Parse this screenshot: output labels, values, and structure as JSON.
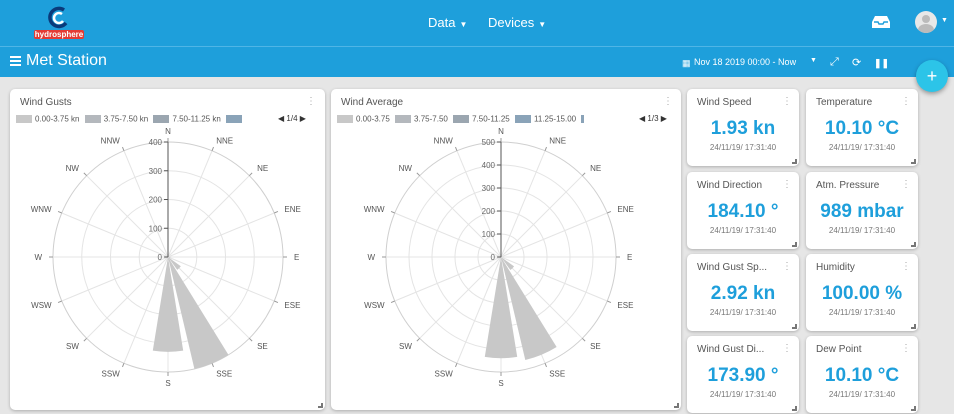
{
  "app": {
    "brand": "hydrosphere"
  },
  "nav": {
    "data_label": "Data",
    "devices_label": "Devices"
  },
  "header": {
    "title": "Met Station",
    "date_range": "Nov 18 2019 00:00 - Now"
  },
  "colors": {
    "accent": "#1e9fdb",
    "fab": "#2cc4e8",
    "wedge": "#c8c8c8"
  },
  "icons": [
    "menu-icon",
    "calendar-icon",
    "expand-icon",
    "refresh-icon",
    "pause-icon",
    "inbox-icon",
    "avatar",
    "kebab-icon",
    "resize-handle-icon",
    "plus-icon"
  ],
  "rose_directions": [
    "N",
    "NNE",
    "NE",
    "ENE",
    "E",
    "ESE",
    "SE",
    "SSE",
    "S",
    "SSW",
    "SW",
    "WSW",
    "W",
    "WNW",
    "NW",
    "NNW"
  ],
  "gusts": {
    "title": "Wind Gusts",
    "legend": [
      "0.00-3.75 kn",
      "3.75-7.50 kn",
      "7.50-11.25 kn"
    ],
    "legend_colors": [
      "#c8c8c8",
      "#b4b8bd",
      "#9ba6b0",
      "#8aa3b8"
    ],
    "pager": "1/4",
    "ticks": [
      "0",
      "100",
      "200",
      "300",
      "400"
    ]
  },
  "average": {
    "title": "Wind Average",
    "legend": [
      "0.00-3.75",
      "3.75-7.50",
      "7.50-11.25",
      "11.25-15.00"
    ],
    "legend_colors": [
      "#c8c8c8",
      "#b4b8bd",
      "#9ba6b0",
      "#8aa3b8",
      "#8aa3b8"
    ],
    "pager": "1/3",
    "ticks": [
      "0",
      "100",
      "200",
      "300",
      "400",
      "500"
    ]
  },
  "tiles": [
    {
      "title": "Wind Speed",
      "value": "1.93 kn",
      "time": "24/11/19/ 17:31:40"
    },
    {
      "title": "Temperature",
      "value": "10.10 °C",
      "time": "24/11/19/ 17:31:40"
    },
    {
      "title": "Wind Direction",
      "value": "184.10 °",
      "time": "24/11/19/ 17:31:40"
    },
    {
      "title": "Atm. Pressure",
      "value": "989 mbar",
      "time": "24/11/19/ 17:31:40"
    },
    {
      "title": "Wind Gust Sp...",
      "value": "2.92 kn",
      "time": "24/11/19/ 17:31:40"
    },
    {
      "title": "Humidity",
      "value": "100.00 %",
      "time": "24/11/19/ 17:31:40"
    },
    {
      "title": "Wind Gust Di...",
      "value": "173.90 °",
      "time": "24/11/19/ 17:31:40"
    },
    {
      "title": "Dew Point",
      "value": "10.10 °C",
      "time": "24/11/19/ 17:31:40"
    }
  ],
  "chart_data": [
    {
      "type": "polar-bar",
      "title": "Wind Gusts",
      "categories": [
        "N",
        "NNE",
        "NE",
        "ENE",
        "E",
        "ESE",
        "SE",
        "SSE",
        "S",
        "SSW",
        "SW",
        "WSW",
        "W",
        "WNW",
        "NW",
        "NNW"
      ],
      "values": [
        0,
        0,
        0,
        0,
        0,
        8,
        55,
        400,
        330,
        0,
        0,
        0,
        0,
        0,
        0,
        0
      ],
      "rmax": 400,
      "legend_placement": "top"
    },
    {
      "type": "polar-bar",
      "title": "Wind Average",
      "categories": [
        "N",
        "NNE",
        "NE",
        "ENE",
        "E",
        "ESE",
        "SE",
        "SSE",
        "S",
        "SSW",
        "SW",
        "WSW",
        "W",
        "WNW",
        "NW",
        "NNW"
      ],
      "values": [
        0,
        0,
        0,
        0,
        0,
        5,
        70,
        460,
        440,
        0,
        0,
        0,
        0,
        0,
        0,
        0
      ],
      "rmax": 500,
      "legend_placement": "top"
    }
  ]
}
